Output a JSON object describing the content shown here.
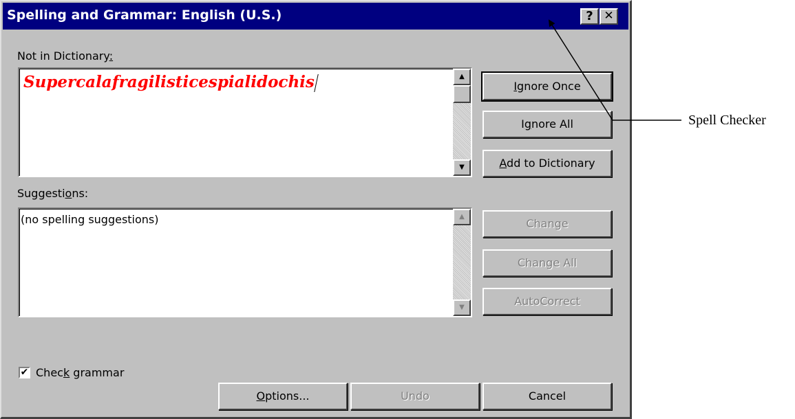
{
  "dialog": {
    "title": "Spelling and Grammar: English (U.S.)",
    "help_glyph": "?",
    "close_glyph": "✕"
  },
  "not_in_dictionary": {
    "label_pre": "Not in Dictionary",
    "label_hotkey": ":",
    "word": "Supercalafragilisticespialidochis"
  },
  "suggestions": {
    "label_pre": "Suggesti",
    "label_hotkey": "o",
    "label_post": "ns:",
    "items": [
      "(no spelling suggestions)"
    ]
  },
  "buttons": {
    "ignore_once": {
      "hotkey": "I",
      "rest": "gnore Once"
    },
    "ignore_all": {
      "pre": "I",
      "hotkey": "g",
      "rest": "nore All"
    },
    "add_to_dictionary": {
      "hotkey": "A",
      "rest": "dd to Dictionary"
    },
    "change": "Change",
    "change_all": "Change All",
    "autocorrect": "AutoCorrect",
    "options": {
      "hotkey": "O",
      "rest": "ptions..."
    },
    "undo": "Undo",
    "cancel": "Cancel"
  },
  "check_grammar": {
    "checked": true,
    "check_glyph": "✔",
    "label_pre": "Chec",
    "label_hotkey": "k",
    "label_post": " grammar"
  },
  "annotation": {
    "text": "Spell Checker"
  },
  "colors": {
    "titlebar": "#000080",
    "dialog_face": "#c0c0c0",
    "misspelled_word": "#ff0000",
    "disabled_text": "#808080"
  },
  "icons": {
    "scroll_up": "▲",
    "scroll_down": "▼"
  }
}
